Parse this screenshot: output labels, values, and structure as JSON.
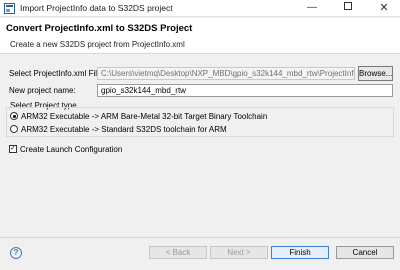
{
  "window": {
    "title": "Import ProjectInfo data to S32DS project",
    "min_symbol": "—",
    "close_symbol": "✕"
  },
  "banner": {
    "title": "Convert ProjectInfo.xml to S32DS Project",
    "description": "Create a new S32DS project from ProjectInfo.xml"
  },
  "form": {
    "select_label": "Select ProjectInfo.xml File:",
    "select_value": "C:\\Users\\vietmq\\Desktop\\NXP_MBD\\gpio_s32k144_mbd_rtw\\ProjectInfo.xml",
    "browse_label": "Browse...",
    "name_label": "New project name:",
    "name_value": "gpio_s32k144_mbd_rtw"
  },
  "project_type": {
    "heading": "Select Project type",
    "options": [
      {
        "label": "ARM32 Executable -> ARM Bare-Metal 32-bit Target Binary Toolchain",
        "selected": true
      },
      {
        "label": "ARM32 Executable -> Standard S32DS toolchain for ARM",
        "selected": false
      }
    ]
  },
  "launch_config": {
    "label": "Create Launch Configuration",
    "checked": true,
    "check_symbol": "✓"
  },
  "footer": {
    "help_symbol": "?",
    "back": "< Back",
    "next": "Next >",
    "finish": "Finish",
    "cancel": "Cancel"
  }
}
